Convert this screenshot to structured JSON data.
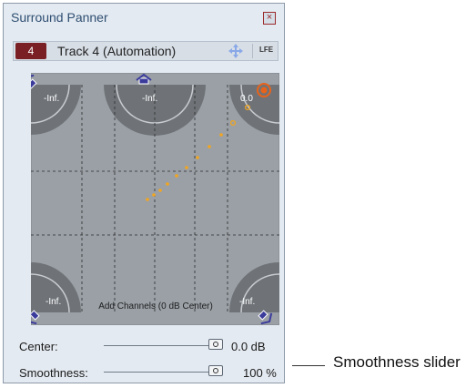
{
  "window": {
    "title": "Surround Panner",
    "close_glyph": "×"
  },
  "track": {
    "number": "4",
    "name": "Track 4 (Automation)",
    "lfe_label": "LFE"
  },
  "speakers": [
    {
      "position": "front-left",
      "level": "-Inf."
    },
    {
      "position": "center",
      "level": "-Inf."
    },
    {
      "position": "front-right",
      "level": "0.0"
    },
    {
      "position": "rear-left",
      "level": "-Inf."
    },
    {
      "position": "rear-right",
      "level": "-Inf."
    }
  ],
  "add_channels_label": "Add Channels (0 dB Center)",
  "controls": {
    "center": {
      "label": "Center:",
      "value": "0.0 dB",
      "level": 1.0
    },
    "smoothness": {
      "label": "Smoothness:",
      "value": "100 %",
      "level": 1.0
    }
  },
  "callout": "Smoothness slider",
  "icons": {
    "close": "close-icon",
    "move": "move-icon",
    "speaker": "speaker-icon",
    "pan_point": "pan-point-icon"
  },
  "colors": {
    "panel_bg": "#e4eaf1",
    "pan_field_bg": "#9aa0a6",
    "speaker_arc": "#6f7378",
    "pan_path": "#f2a51f",
    "pan_point": "#e8631a",
    "track_badge": "#7a1f24"
  }
}
